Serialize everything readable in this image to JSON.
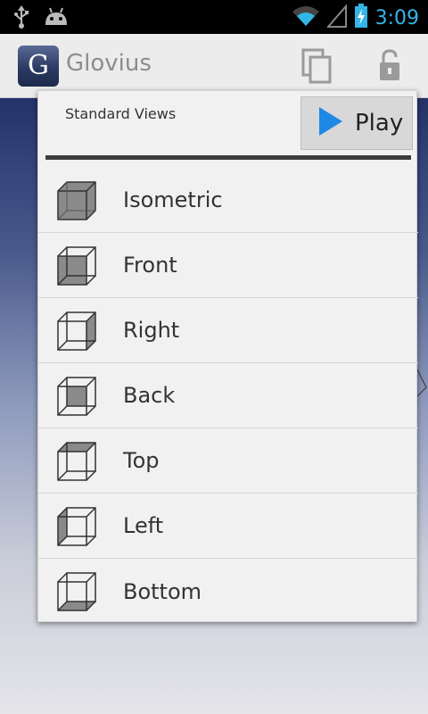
{
  "status_bar": {
    "time": "3:09",
    "icons": [
      "usb-icon",
      "android-icon",
      "wifi-icon",
      "signal-icon",
      "battery-charging-icon"
    ]
  },
  "action_bar": {
    "logo_letter": "G",
    "title": "Glovius",
    "actions": [
      "copy-icon",
      "lock-icon"
    ]
  },
  "popup": {
    "heading": "Standard Views",
    "play_label": "Play",
    "views": [
      {
        "label": "Isometric",
        "icon": "cube-isometric-icon"
      },
      {
        "label": "Front",
        "icon": "cube-front-icon"
      },
      {
        "label": "Right",
        "icon": "cube-right-icon"
      },
      {
        "label": "Back",
        "icon": "cube-back-icon"
      },
      {
        "label": "Top",
        "icon": "cube-top-icon"
      },
      {
        "label": "Left",
        "icon": "cube-left-icon"
      },
      {
        "label": "Bottom",
        "icon": "cube-bottom-icon"
      }
    ]
  },
  "colors": {
    "clock": "#33b5e5",
    "play_triangle": "#1e88e5"
  }
}
